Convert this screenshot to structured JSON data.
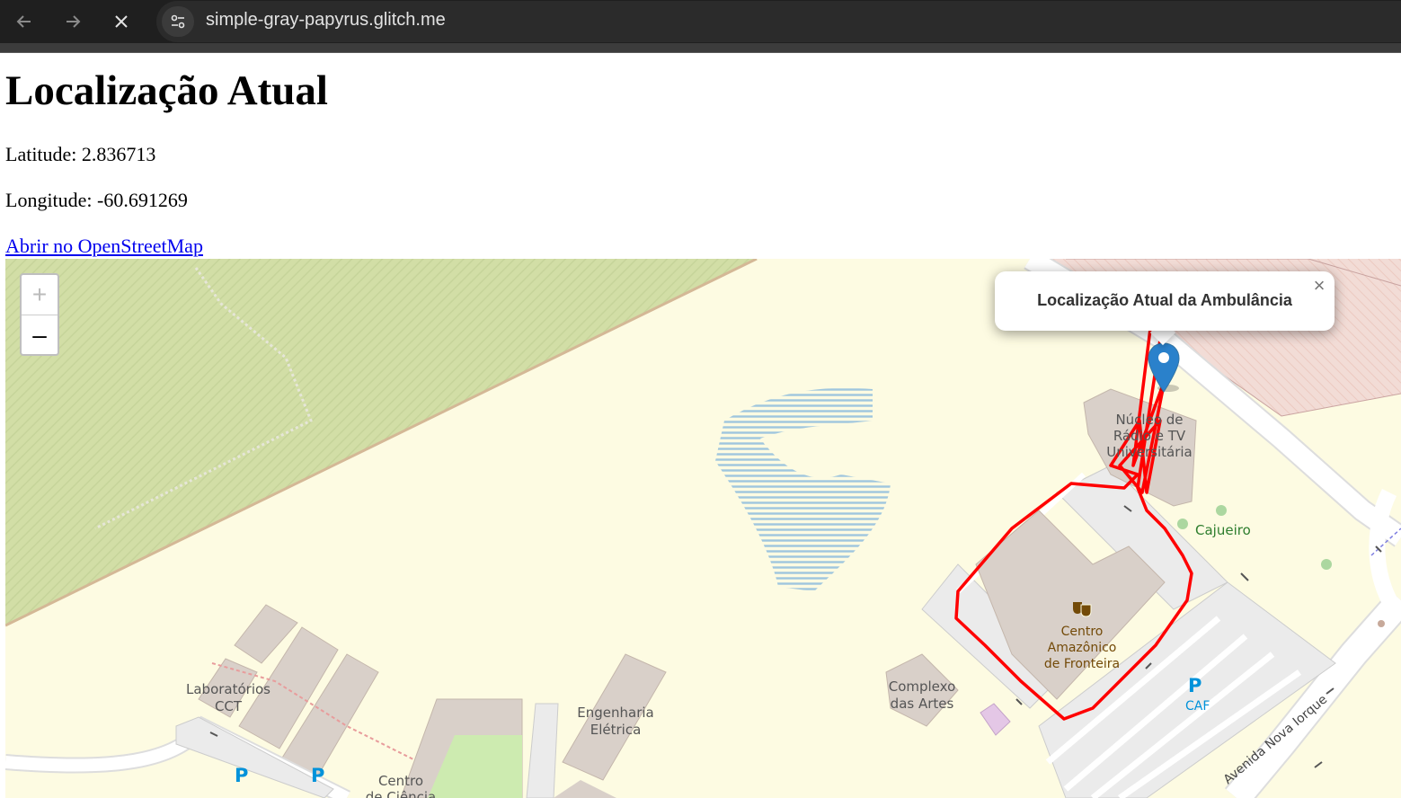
{
  "browser": {
    "url": "simple-gray-papyrus.glitch.me"
  },
  "page": {
    "title": "Localização Atual",
    "latitude_text": "Latitude: 2.836713",
    "longitude_text": "Longitude: -60.691269",
    "osm_link_label": "Abrir no OpenStreetMap"
  },
  "map": {
    "zoom_in_label": "+",
    "zoom_out_label": "–",
    "popup": {
      "text": "Localização Atual da Ambulância",
      "close_label": "×"
    },
    "labels": {
      "nucleo": "Núcleo de Rádio e TV Universitária",
      "cajueiro": "Cajueiro",
      "centro_line1": "Centro",
      "centro_line2": "Amazônico",
      "centro_line3": "de Fronteira",
      "complexo_line1": "Complexo",
      "complexo_line2": "das Artes",
      "lab_line1": "Laboratórios",
      "lab_line2": "CCT",
      "eng_line1": "Engenharia",
      "eng_line2": "Elétrica",
      "caf": "CAF",
      "parking": "P",
      "centro_ciencia_line1": "Centro",
      "centro_ciencia_line2": "de Ciência",
      "street": "Avenida Nova Iorque"
    },
    "colors": {
      "track": "#ff0000",
      "marker": "#2a81cb",
      "land": "#fdfbe2",
      "park": "#d2dea6",
      "building": "#d9d0c9"
    }
  }
}
